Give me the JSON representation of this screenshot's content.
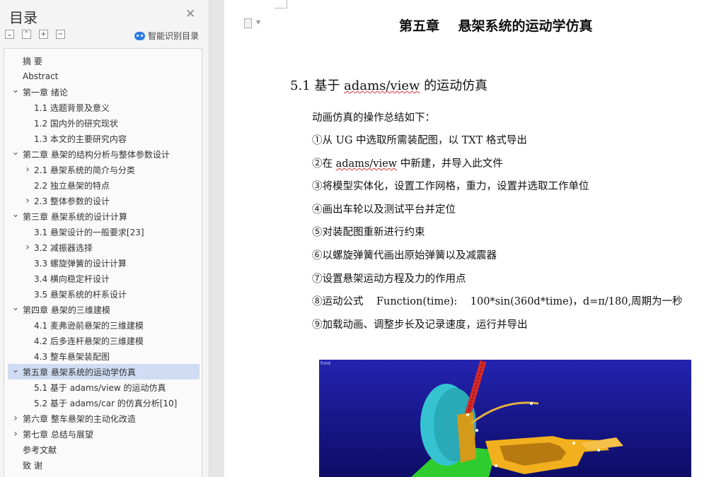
{
  "outline": {
    "title": "目录",
    "smart_label": "智能识别目录",
    "items": [
      {
        "label": "摘    要",
        "level": 1,
        "expander": "none"
      },
      {
        "label": "Abstract",
        "level": 1,
        "expander": "none"
      },
      {
        "label": "第一章    绪论",
        "level": 1,
        "expander": "expanded"
      },
      {
        "label": "1.1 选题背景及意义",
        "level": 2,
        "expander": "none"
      },
      {
        "label": "1.2 国内外的研究现状",
        "level": 2,
        "expander": "none"
      },
      {
        "label": "1.3 本文的主要研究内容",
        "level": 2,
        "expander": "none"
      },
      {
        "label": "第二章    悬架的结构分析与整体参数设计",
        "level": 1,
        "expander": "expanded"
      },
      {
        "label": "2.1 悬架系统的简介与分类",
        "level": 2,
        "expander": "collapsed"
      },
      {
        "label": "2.2 独立悬架的特点",
        "level": 2,
        "expander": "none"
      },
      {
        "label": "2.3 整体参数的设计",
        "level": 2,
        "expander": "collapsed"
      },
      {
        "label": "第三章    悬架系统的设计计算",
        "level": 1,
        "expander": "expanded"
      },
      {
        "label": "3.1 悬架设计的一般要求[23]",
        "level": 2,
        "expander": "none"
      },
      {
        "label": "3.2 减振器选择",
        "level": 2,
        "expander": "collapsed"
      },
      {
        "label": "3.3 螺旋弹簧的设计计算",
        "level": 2,
        "expander": "none"
      },
      {
        "label": "3.4 横向稳定杆设计",
        "level": 2,
        "expander": "none"
      },
      {
        "label": "3.5 悬架系统的杆系设计",
        "level": 2,
        "expander": "none"
      },
      {
        "label": "第四章    悬架的三维建模",
        "level": 1,
        "expander": "expanded"
      },
      {
        "label": "4.1 麦弗逊前悬架的三维建模",
        "level": 2,
        "expander": "none"
      },
      {
        "label": "4.2 后多连杆悬架的三维建模",
        "level": 2,
        "expander": "none"
      },
      {
        "label": "4.3 整车悬架装配图",
        "level": 2,
        "expander": "none"
      },
      {
        "label": "第五章    悬架系统的运动学仿真",
        "level": 1,
        "expander": "expanded",
        "selected": true
      },
      {
        "label": "5.1 基于 adams/view 的运动仿真",
        "level": 2,
        "expander": "none"
      },
      {
        "label": "5.2 基于 adams/car 的仿真分析[10]",
        "level": 2,
        "expander": "none"
      },
      {
        "label": "第六章    整车悬架的主动化改造",
        "level": 1,
        "expander": "collapsed"
      },
      {
        "label": "第七章    总结与展望",
        "level": 1,
        "expander": "collapsed"
      },
      {
        "label": "参考文献",
        "level": 1,
        "expander": "none"
      },
      {
        "label": "致    谢",
        "level": 1,
        "expander": "none"
      }
    ]
  },
  "document": {
    "chapter_title": "第五章    悬架系统的运动学仿真",
    "section_number": "5.1 基于 ",
    "section_word": "adams/view",
    "section_rest": " 的运动仿真",
    "intro": "动画仿真的操作总结如下：",
    "step1": "①从 UG 中选取所需装配图，以 TXT 格式导出",
    "step2_pre": "②在 ",
    "step2_word": "adams/view",
    "step2_post": " 中新建，并导入此文件",
    "step3": "③将模型实体化，设置工作网格，重力，设置并选取工作单位",
    "step4": "④画出车轮以及测试平台并定位",
    "step5": "⑤对装配图重新进行约束",
    "step6": "⑥以螺旋弹簧代画出原始弹簧以及减震器",
    "step7": "⑦设置悬架运动方程及力的作用点",
    "step8": "⑧运动公式    Function(time):    100*sin(360d*time)，d=π/180,周期为一秒",
    "step9": "⑨加载动画、调整步长及记录速度，运行并导出",
    "image_label": "front"
  },
  "colors": {
    "selected_row": "#cfdcf3",
    "sim_background": "#1a1a8c",
    "tire": "#33c9d6",
    "spring": "#d42a2a",
    "frame": "#f2b01e",
    "ground": "#29c729"
  }
}
